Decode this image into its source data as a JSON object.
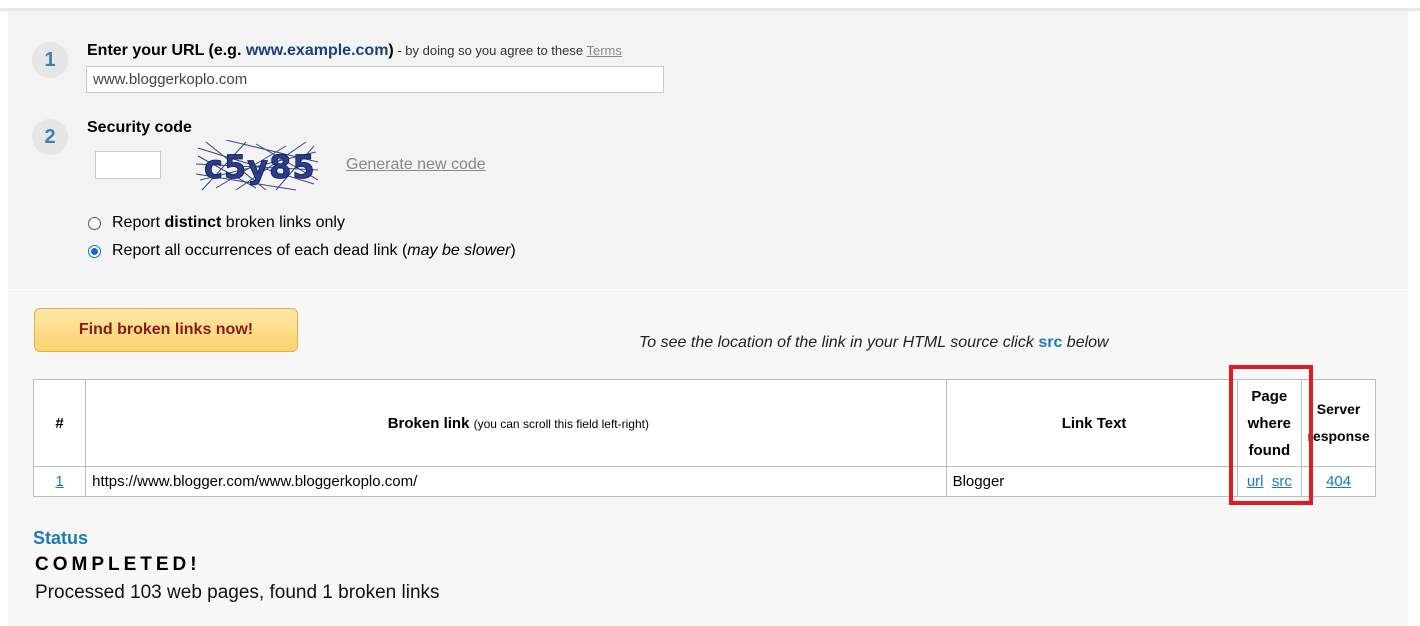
{
  "step1": {
    "number": "1",
    "label_prefix": "Enter your URL (e.g.",
    "label_example": "www.example.com",
    "label_suffix": ")",
    "agree_text": " - by doing so you agree to these ",
    "terms_link": "Terms",
    "url_value": "www.bloggerkoplo.com"
  },
  "step2": {
    "number": "2",
    "label": "Security code",
    "code_value": "",
    "captcha_text": "c5y85",
    "generate_link": "Generate new code"
  },
  "options": {
    "distinct_pre": "Report ",
    "distinct_bold": "distinct",
    "distinct_post": " broken links only",
    "all_pre": "Report all occurrences of each dead link (",
    "all_italic": "may be slower",
    "all_post": ")",
    "selected": "all"
  },
  "find_button": "Find broken links now!",
  "hint": {
    "pre": "To see the location of the link in your HTML source click ",
    "src": "src",
    "post": " below"
  },
  "table": {
    "headers": {
      "num": "#",
      "link": "Broken link",
      "link_note": "(you can scroll this field left-right)",
      "text": "Link Text",
      "page_line1": "Page",
      "page_line2": "where",
      "page_line3": "found",
      "resp_line1": "Server",
      "resp_line2": "response"
    },
    "rows": [
      {
        "num": "1",
        "link": "https://www.blogger.com/www.bloggerkoplo.com/",
        "text": "Blogger",
        "url_label": "url",
        "src_label": "src",
        "response": "404"
      }
    ]
  },
  "status": {
    "title": "Status",
    "value": "COMPLETED!",
    "message": "Processed 103 web pages, found 1 broken links"
  },
  "colors": {
    "accent_blue": "#1d7ab8",
    "highlight_red": "#e01b24",
    "button_text": "#8b1a1a"
  }
}
